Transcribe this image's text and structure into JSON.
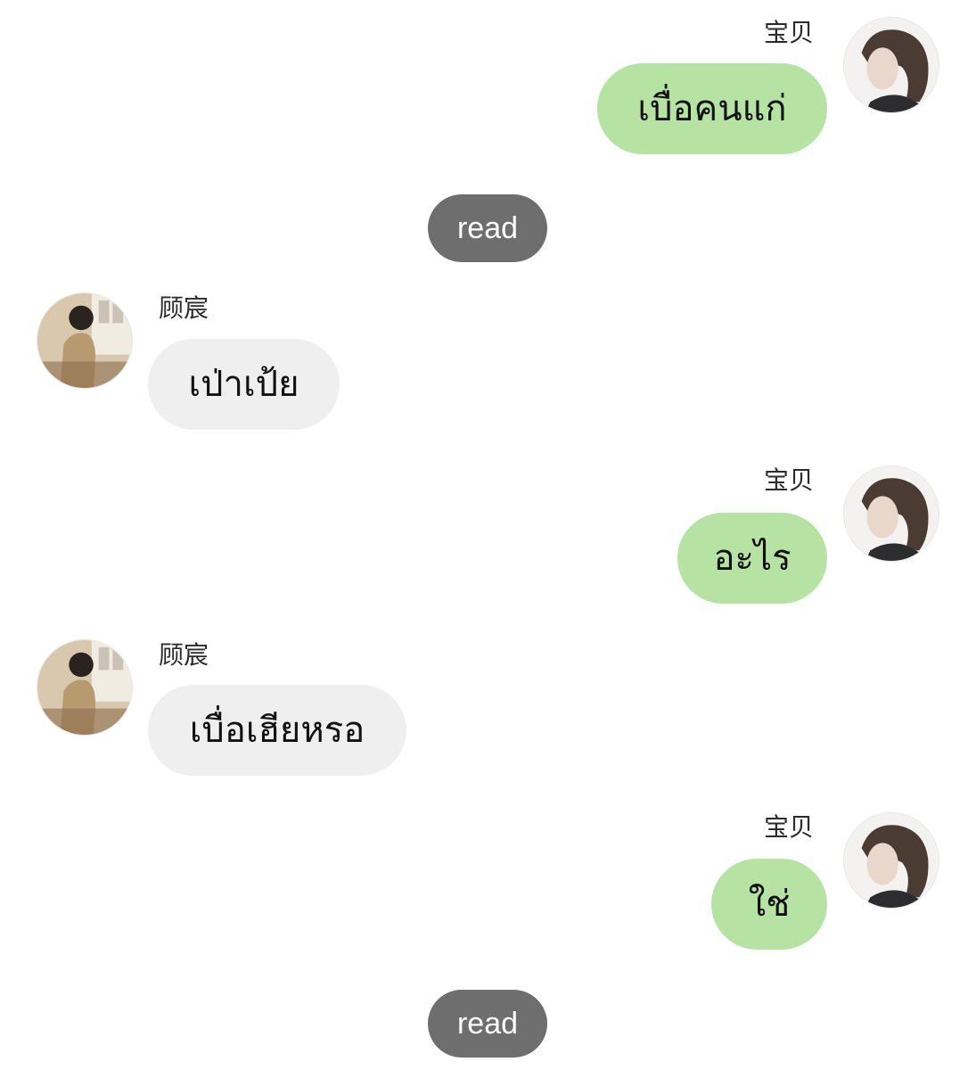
{
  "names": {
    "me": "宝贝",
    "other": "顾宸"
  },
  "messages": [
    {
      "from": "me",
      "text": "เบื่อคนแก่"
    },
    {
      "read": "read"
    },
    {
      "from": "other",
      "text": "เป่าเป้ย"
    },
    {
      "from": "me",
      "text": "อะไร"
    },
    {
      "from": "other",
      "text": "เบื่อเฮียหรอ"
    },
    {
      "from": "me",
      "text": "ใช่"
    },
    {
      "read": "read"
    }
  ],
  "colors": {
    "my_bubble": "#b6e3a4",
    "their_bubble": "#efefef",
    "read_pill": "#6e6e6e"
  },
  "icons": {
    "my_avatar": "avatar-photo-icon",
    "their_avatar": "avatar-photo-icon"
  }
}
